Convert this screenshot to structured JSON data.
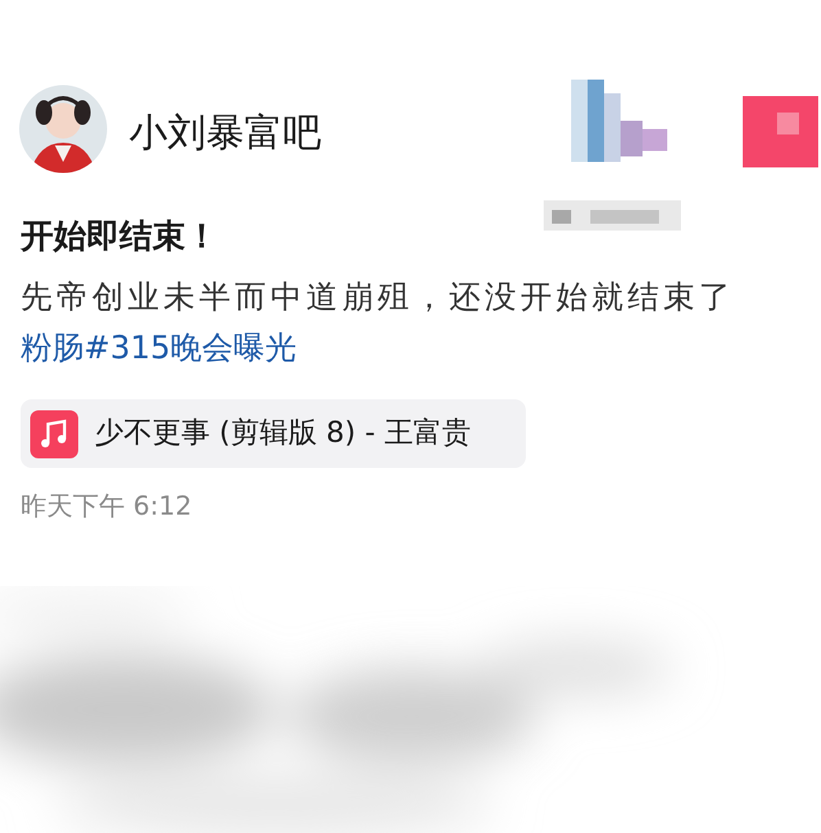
{
  "author": {
    "name": "小刘暴富吧"
  },
  "post": {
    "title": "开始即结束！",
    "body": "先帝创业未半而中道崩殂，还没开始就结束了",
    "topic": "粉肠#315晚会曝光"
  },
  "music": {
    "label": "少不更事 (剪辑版 8) - 王富贵"
  },
  "timestamp": "昨天下午 6:12"
}
